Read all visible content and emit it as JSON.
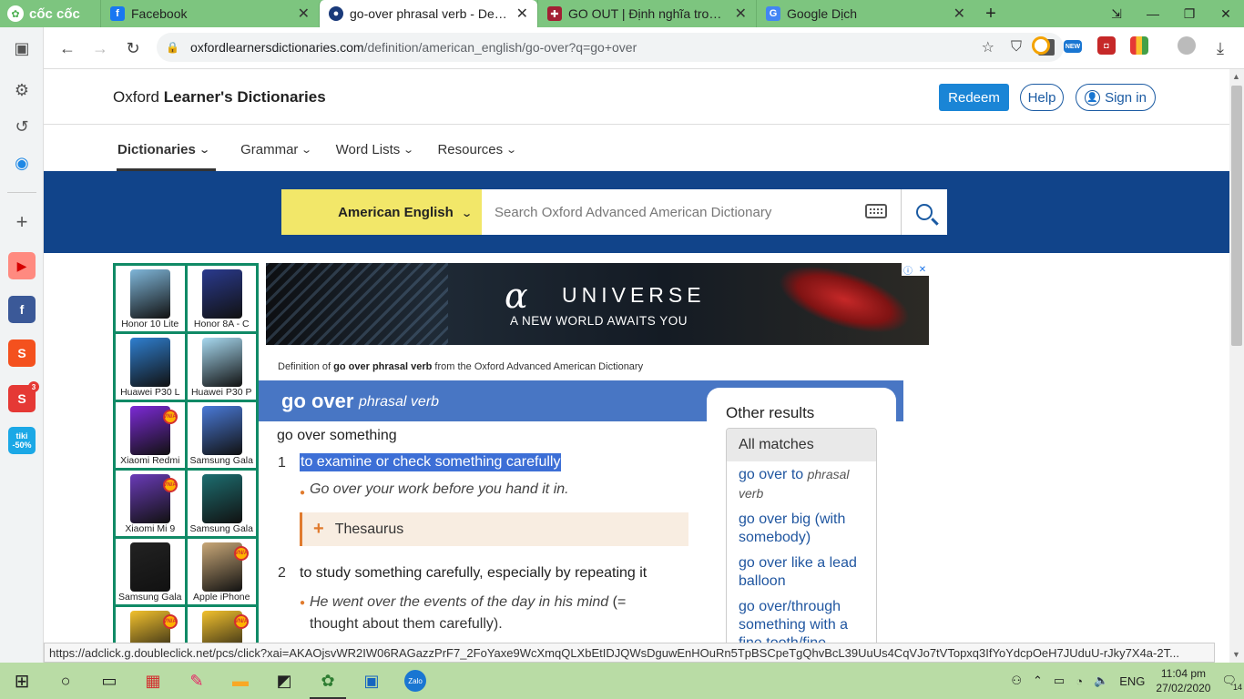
{
  "browser": {
    "brand": "cốc cốc",
    "tabs": [
      {
        "title": "Facebook",
        "icon": "facebook-icon"
      },
      {
        "title": "go-over phrasal verb - Definiti",
        "icon": "oxford-icon",
        "active": true
      },
      {
        "title": "GO OUT | Định nghĩa trong Tiếng",
        "icon": "cambridge-icon"
      },
      {
        "title": "Google Dịch",
        "icon": "google-translate-icon"
      }
    ],
    "url_host": "oxfordlearnersdictionaries.com",
    "url_path": "/definition/american_english/go-over?q=go+over",
    "status_url": "https://adclick.g.doubleclick.net/pcs/click?xai=AKAOjsvWR2IW06RAGazzPrF7_2FoYaxe9WcXmqQLXbEtIDJQWsDguwEnHOuRn5TpBSCpeTgQhvBcL39UuUs4CqVJo7tVTopxq3IfYoYdcpOeH7JUduU-rJky7X4a-2T..."
  },
  "site": {
    "logo_plain": "Oxford ",
    "logo_bold": "Learner's Dictionaries",
    "redeem": "Redeem",
    "help": "Help",
    "signin": "Sign in",
    "nav": [
      "Dictionaries",
      "Grammar",
      "Word Lists",
      "Resources"
    ],
    "dictionary_select": "American English",
    "search_placeholder": "Search Oxford Advanced American Dictionary"
  },
  "left_ad": {
    "products": [
      "Honor 10 Lite",
      "Honor 8A - C",
      "Huawei P30 L",
      "Huawei P30 P",
      "Xiaomi Redmi",
      "Samsung Gala",
      "Xiaomi Mi 9",
      "Samsung Gala",
      "Samsung Gala",
      "Apple iPhone",
      "",
      ""
    ]
  },
  "banner_ad": {
    "logo": "α",
    "brand": "UNIVERSE",
    "tagline": "A NEW WORLD AWAITS YOU"
  },
  "entry": {
    "def_from_pre": "Definition of ",
    "def_from_word": "go over phrasal verb",
    "def_from_post": " from the Oxford Advanced American Dictionary",
    "headword": "go over",
    "pos": "phrasal verb",
    "pattern": "go over something",
    "senses": [
      {
        "num": "1",
        "def": "to examine or check something carefully",
        "example": "Go over your work before you hand it in."
      },
      {
        "num": "2",
        "def": "to study something carefully, especially by repeating it",
        "example": "He went over the events of the day in his mind",
        "example_gloss": " (= thought about them carefully)."
      }
    ],
    "thesaurus": "Thesaurus"
  },
  "other_results": {
    "title": "Other results",
    "all_matches": "All matches",
    "items": [
      {
        "text": "go over to",
        "pos": "phrasal verb"
      },
      {
        "text": "go over big (with somebody)"
      },
      {
        "text": "go over like a lead balloon"
      },
      {
        "text": "go over/through something with a fine tooth/fine"
      }
    ]
  },
  "taskbar": {
    "lang": "ENG",
    "time": "11:04 pm",
    "date": "27/02/2020",
    "notifications": "14"
  },
  "colors": {
    "browser_green": "#7dc57f",
    "oxford_blue": "#11448a",
    "dict_yellow": "#f2e769",
    "headword_band": "#4876c4",
    "link_blue": "#2056a0",
    "accent_orange": "#e07b2e"
  }
}
